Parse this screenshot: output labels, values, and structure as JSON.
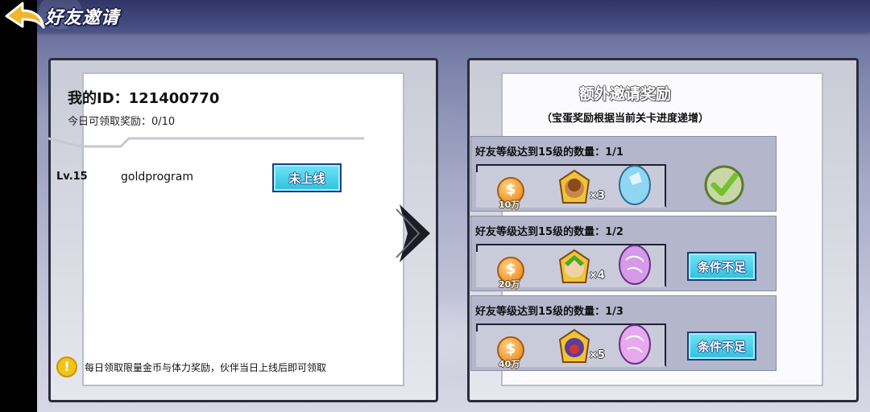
{
  "header": {
    "title": "好友邀请"
  },
  "left_panel": {
    "my_id": "我的ID：121400770",
    "today_rewards": "今日可领取奖励：0/10",
    "friends": [
      {
        "level": "Lv.15",
        "name": "goldprogram",
        "status": "未上线"
      }
    ],
    "notice": "每日领取限量金币与体力奖励，伙伴当日上线后即可领取"
  },
  "right_panel": {
    "title": "额外邀请奖励",
    "subtitle": "（宝蛋奖励根据当前关卡进度递增）",
    "rows": [
      {
        "label": "好友等级达到15级的数量：1/1",
        "coin": "10万",
        "hero_count": "×3",
        "egg_color": "#8fd6f2",
        "state": "completed"
      },
      {
        "label": "好友等级达到15级的数量：1/2",
        "coin": "20万",
        "hero_count": "×4",
        "egg_color": "#d59ae8",
        "state": "locked",
        "button": "条件不足"
      },
      {
        "label": "好友等级达到15级的数量：1/3",
        "coin": "40万",
        "hero_count": "×5",
        "egg_color": "#e6a9ee",
        "state": "locked",
        "button": "条件不足"
      }
    ]
  },
  "colors": {
    "button_cyan": "#2ec0de",
    "coin_orange": "#f0962a",
    "check_green": "#74c12e"
  }
}
